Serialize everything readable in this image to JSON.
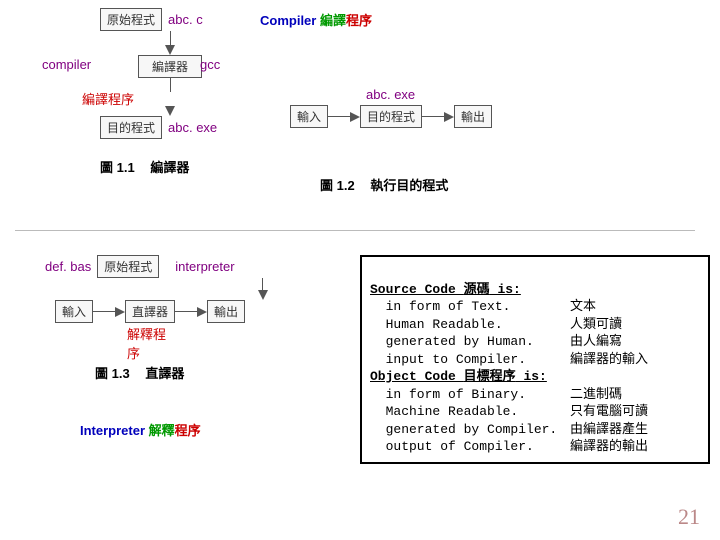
{
  "top": {
    "src_label": "原始程式",
    "src_file": "abc. c",
    "compiler_en": "compiler",
    "compiler_box": "編譯器",
    "gcc": "gcc",
    "step_label": "編譯程序",
    "obj_label": "目的程式",
    "obj_file": "abc. exe",
    "fig1_num": "圖 1.1",
    "fig1_title": "編譯器",
    "input_label": "輸入",
    "obj_label2": "目的程式",
    "obj_file2": "abc. exe",
    "output_label": "輸出",
    "fig2_num": "圖 1.2",
    "fig2_title": "執行目的程式",
    "title_compiler_a": "Compiler ",
    "title_compiler_b": "編譯",
    "title_compiler_c": "程序"
  },
  "bottom": {
    "src_label": "原始程式",
    "src_file": "def. bas",
    "interpreter_en": "interpreter",
    "interp_box": "直譯器",
    "input_label": "輸入",
    "step_label": "解釋程序",
    "output_label": "輸出",
    "fig3_num": "圖 1.3",
    "fig3_title": "直譯器",
    "title_interp_a": "Interpreter ",
    "title_interp_b": "解釋",
    "title_interp_c": "程序"
  },
  "codebox": {
    "l1a": "Source Code ",
    "l1b": "源碼",
    "l1c": " is:",
    "l2a": "  in form of Text.",
    "l2b": "文本",
    "l3a": "  Human Readable.",
    "l3b": "人類可讀",
    "l4a": "  generated by Human.",
    "l4b": "由人編寫",
    "l5a": "  input to Compiler.",
    "l5b": "編譯器的輸入",
    "l6a": "Object Code ",
    "l6b": "目標程序",
    "l6c": " is:",
    "l7a": "  in form of Binary.",
    "l7b": "二進制碼",
    "l8a": "  Machine Readable.",
    "l8b": "只有電腦可讀",
    "l9a": "  generated by Compiler.",
    "l9b": "由編譯器產生",
    "l10a": "  output of Compiler.",
    "l10b": "編譯器的輸出"
  },
  "pagenum": "21"
}
